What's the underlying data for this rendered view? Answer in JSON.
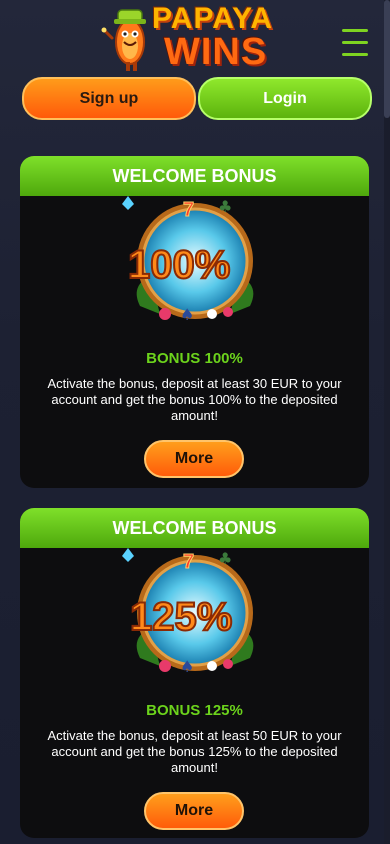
{
  "brand": {
    "line1": "PAPAYA",
    "line2": "WINS"
  },
  "header": {
    "signup_label": "Sign up",
    "login_label": "Login",
    "menu_icon": "hamburger-menu-icon"
  },
  "colors": {
    "accent_green": "#7ed321",
    "accent_orange": "#ff6a12",
    "background": "#1d2133"
  },
  "bonuses": [
    {
      "header": "WELCOME BONUS",
      "percent_text": "100%",
      "name": "BONUS 100%",
      "description": "Activate the bonus, deposit at least 30 EUR to your account and get the bonus 100% to the deposited amount!",
      "more_label": "More"
    },
    {
      "header": "WELCOME BONUS",
      "percent_text": "125%",
      "name": "BONUS 125%",
      "description": "Activate the bonus, deposit at least 50 EUR to your account and get the bonus 125% to the deposited amount!",
      "more_label": "More"
    }
  ]
}
